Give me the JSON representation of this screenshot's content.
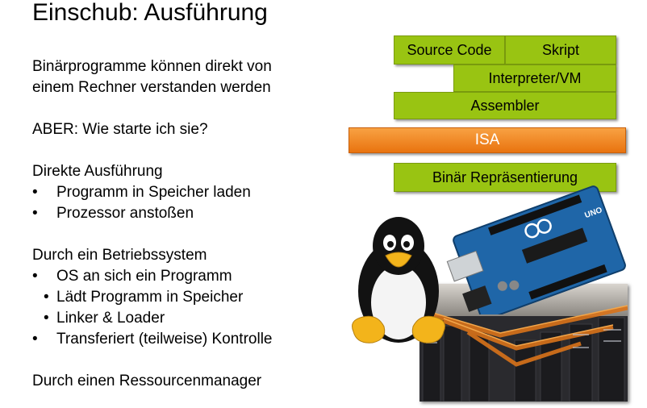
{
  "slide": {
    "title": "Einschub: Ausführung"
  },
  "content": {
    "p1_line1": "Binärprogramme können direkt von",
    "p1_line2": "einem Rechner verstanden werden",
    "p2": "ABER: Wie starte ich sie?",
    "direct_heading": "Direkte Ausführung",
    "direct_items": [
      "Programm in Speicher laden",
      "Prozessor anstoßen"
    ],
    "os_heading": "Durch ein Betriebssystem",
    "os_item1": "OS an sich ein Programm",
    "os_subitems": [
      "Lädt Programm in Speicher",
      "Linker & Loader"
    ],
    "os_item2": "Transferiert (teilweise) Kontrolle",
    "rm_heading": "Durch einen Ressourcenmanager",
    "bullet_char": "•"
  },
  "stack": {
    "source_code": "Source Code",
    "skript": "Skript",
    "interpreter": "Interpreter/VM",
    "assembler": "Assembler",
    "isa": "ISA",
    "binary": "Binär Repräsentierung"
  },
  "colors": {
    "green": "#99c412",
    "orange": "#ee7b15",
    "arduino_blue": "#1f66a8"
  },
  "arduino_board": {
    "logo_text": "UNO"
  }
}
